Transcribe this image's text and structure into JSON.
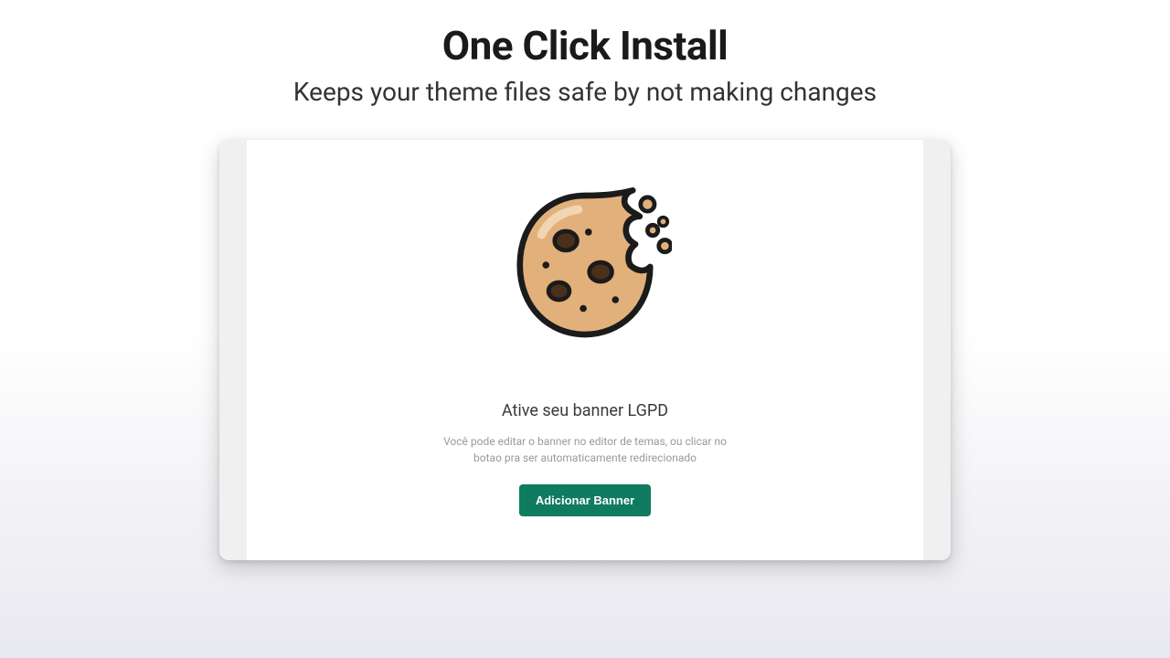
{
  "header": {
    "title": "One Click Install",
    "subtitle": "Keeps your theme files safe by not making changes"
  },
  "card": {
    "icon_name": "cookie-icon",
    "heading": "Ative seu banner LGPD",
    "description": "Você pode editar o banner no editor de temas, ou clicar no botao pra ser automaticamente redirecionado",
    "button_label": "Adicionar Banner"
  },
  "colors": {
    "button_bg": "#0f7b5f",
    "cookie_fill": "#e2b07a",
    "cookie_stroke": "#1b1b1b",
    "chip_dark": "#4a2f1a"
  }
}
